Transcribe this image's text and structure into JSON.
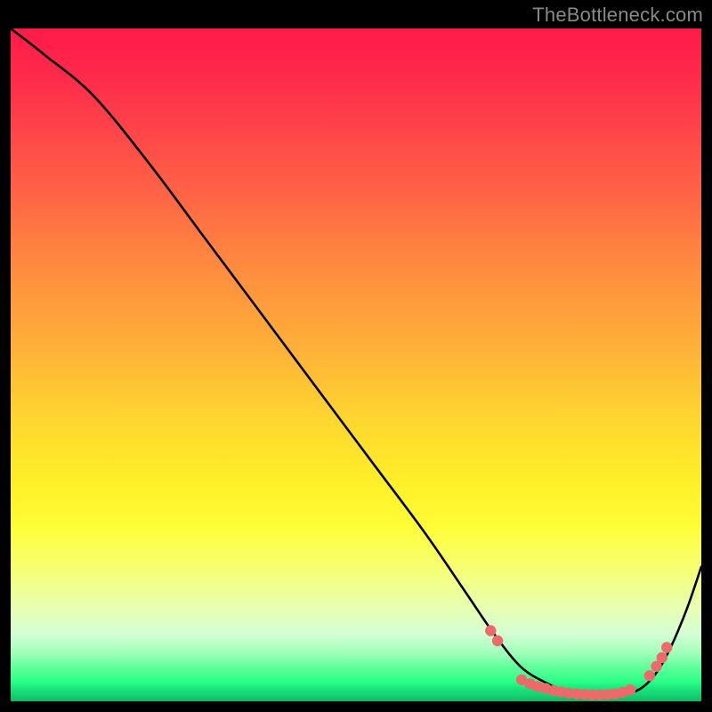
{
  "attribution": "TheBottleneck.com",
  "colors": {
    "background": "#000000",
    "curve": "#000000",
    "marker_fill": "#ec6a6a",
    "marker_stroke": "#c94f4f",
    "attribution_text": "#888888"
  },
  "chart_data": {
    "type": "line",
    "title": "",
    "xlabel": "",
    "ylabel": "",
    "xlim": [
      0,
      100
    ],
    "ylim": [
      0,
      100
    ],
    "series": [
      {
        "name": "bottleneck-curve",
        "x": [
          0,
          5,
          12,
          20,
          28,
          36,
          44,
          52,
          60,
          66,
          70,
          74,
          78,
          80,
          82,
          84,
          86,
          88,
          90,
          92,
          94,
          96,
          98,
          100
        ],
        "y": [
          100,
          96,
          90,
          80,
          69,
          58,
          47,
          36,
          25,
          16,
          10,
          5,
          2.5,
          1.6,
          1.1,
          0.9,
          0.9,
          1.0,
          1.3,
          2.5,
          5,
          9,
          14,
          20
        ]
      }
    ],
    "markers": {
      "name": "marker-cluster",
      "points": [
        {
          "x": 69.5,
          "y": 10.5
        },
        {
          "x": 70.5,
          "y": 9.0
        },
        {
          "x": 74.0,
          "y": 3.2
        },
        {
          "x": 75.2,
          "y": 2.6
        },
        {
          "x": 76.3,
          "y": 2.2
        },
        {
          "x": 77.5,
          "y": 1.9
        },
        {
          "x": 78.6,
          "y": 1.6
        },
        {
          "x": 79.7,
          "y": 1.4
        },
        {
          "x": 80.8,
          "y": 1.2
        },
        {
          "x": 82.0,
          "y": 1.1
        },
        {
          "x": 83.1,
          "y": 1.0
        },
        {
          "x": 84.2,
          "y": 0.95
        },
        {
          "x": 85.3,
          "y": 0.95
        },
        {
          "x": 86.4,
          "y": 1.0
        },
        {
          "x": 87.5,
          "y": 1.1
        },
        {
          "x": 88.6,
          "y": 1.3
        },
        {
          "x": 89.7,
          "y": 1.7
        },
        {
          "x": 92.5,
          "y": 3.8
        },
        {
          "x": 93.5,
          "y": 5.2
        },
        {
          "x": 94.3,
          "y": 6.5
        },
        {
          "x": 95.0,
          "y": 8.0
        }
      ]
    },
    "gradient_stops": [
      {
        "pct": 0,
        "color": "#ff1a4a"
      },
      {
        "pct": 25,
        "color": "#ff6545"
      },
      {
        "pct": 50,
        "color": "#ffc634"
      },
      {
        "pct": 75,
        "color": "#fffd36"
      },
      {
        "pct": 90,
        "color": "#d4ffd4"
      },
      {
        "pct": 97,
        "color": "#2dff89"
      },
      {
        "pct": 100,
        "color": "#0fb962"
      }
    ]
  }
}
